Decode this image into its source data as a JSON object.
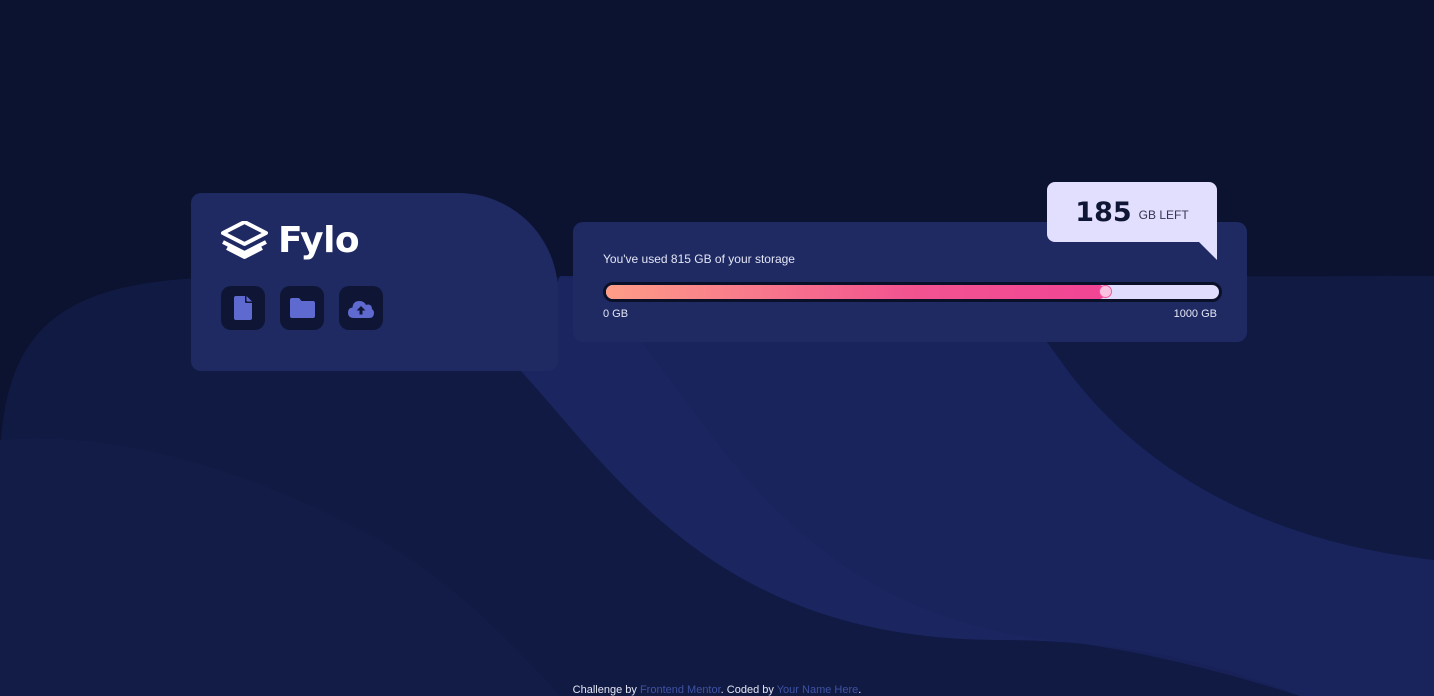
{
  "app": {
    "logo_text": "Fylo"
  },
  "toolbar": {
    "icons": [
      {
        "name": "document-icon"
      },
      {
        "name": "folder-icon"
      },
      {
        "name": "upload-icon"
      }
    ]
  },
  "storage": {
    "usage_text": "You've used 815 GB of your storage",
    "used_gb": 815,
    "total_gb": 1000,
    "used_fraction": 0.815,
    "min_label": "0 GB",
    "max_label": "1000 GB",
    "remaining_number": "185",
    "remaining_unit": "GB LEFT"
  },
  "footer": {
    "prefix": "Challenge by ",
    "link1": "Frontend Mentor",
    "middle": ". Coded by ",
    "link2": "Your Name Here",
    "suffix": "."
  },
  "colors": {
    "background": "#0c1330",
    "card": "#1f2a63",
    "icon_bg": "#0f1535",
    "icon": "#5f6ad0",
    "bubble": "#e2defd",
    "gradient_start": "#fe9d87",
    "gradient_end": "#f14495",
    "link": "#3e52a3"
  }
}
